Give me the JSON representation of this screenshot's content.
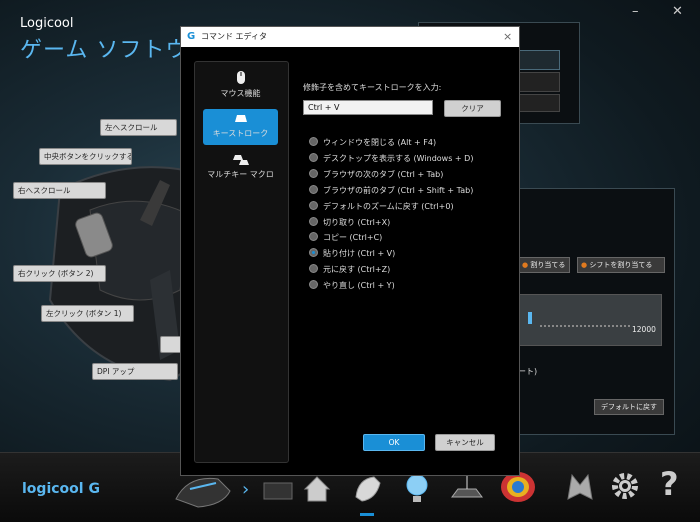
{
  "app": {
    "brand_small": "Logicool",
    "brand_large": "ゲーム ソフトウェア"
  },
  "mouse_callouts": [
    {
      "label": "左へスクロール"
    },
    {
      "label": "中央ボタンをクリックする (?"
    },
    {
      "label": "右へスクロール"
    },
    {
      "label": "右クリック (ボタン 2)"
    },
    {
      "label": "左クリック (ボタン 1)"
    },
    {
      "label": "DPI アップ"
    }
  ],
  "background_panel": {
    "assign_button_partial": "割り当てる",
    "shift_assign_button": "シフトを割り当てる",
    "dpi_max": "12000",
    "report_partial": "ート)",
    "default_button": "デフォルトに戻す"
  },
  "bottom_bar": {
    "logo": "logicool"
  },
  "dialog": {
    "title": "コマンド エディタ",
    "close_glyph": "×",
    "sidebar": [
      {
        "label": "マウス機能",
        "icon": "mouse-icon",
        "selected": false
      },
      {
        "label": "キーストローク",
        "icon": "key-icon",
        "selected": true
      },
      {
        "label": "マルチキー マクロ",
        "icon": "multikey-icon",
        "selected": false
      }
    ],
    "prompt": "修飾子を含めてキーストロークを入力:",
    "keystroke_value": "Ctrl + V",
    "clear_label": "クリア",
    "options": [
      {
        "label": "ウィンドウを閉じる (Alt + F4)",
        "selected": false
      },
      {
        "label": "デスクトップを表示する (Windows + D)",
        "selected": false
      },
      {
        "label": "ブラウザの次のタブ (Ctrl + Tab)",
        "selected": false
      },
      {
        "label": "ブラウザの前のタブ (Ctrl + Shift + Tab)",
        "selected": false
      },
      {
        "label": "デフォルトのズームに戻す (Ctrl+0)",
        "selected": false
      },
      {
        "label": "切り取り (Ctrl+X)",
        "selected": false
      },
      {
        "label": "コピー (Ctrl+C)",
        "selected": false
      },
      {
        "label": "貼り付け (Ctrl + V)",
        "selected": true
      },
      {
        "label": "元に戻す (Ctrl+Z)",
        "selected": false
      },
      {
        "label": "やり直し (Ctrl + Y)",
        "selected": false
      }
    ],
    "ok_label": "OK",
    "cancel_label": "キャンセル"
  },
  "colors": {
    "accent": "#1a8fd6",
    "brand_blue": "#5ab7f0",
    "orange": "#e07a1f"
  }
}
